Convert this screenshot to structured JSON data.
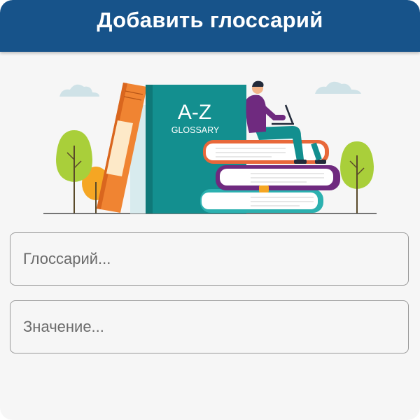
{
  "app_bar": {
    "title": "Добавить глоссарий"
  },
  "illustration": {
    "book_title": "A-Z",
    "book_subtitle": "GLOSSARY",
    "colors": {
      "teal_book": "#138f8f",
      "orange_book": "#f08432",
      "tree_green": "#a9cf3a",
      "tree_orange": "#f5a623",
      "purple": "#6f2a7f",
      "cloud": "#cfe2e7"
    }
  },
  "form": {
    "glossary_input": {
      "value": "",
      "placeholder": "Глоссарий..."
    },
    "meaning_input": {
      "value": "",
      "placeholder": "Значение..."
    }
  },
  "colors": {
    "app_bar": "#17538a",
    "background": "#f6f6f6",
    "field_border": "#9a9a9a"
  }
}
